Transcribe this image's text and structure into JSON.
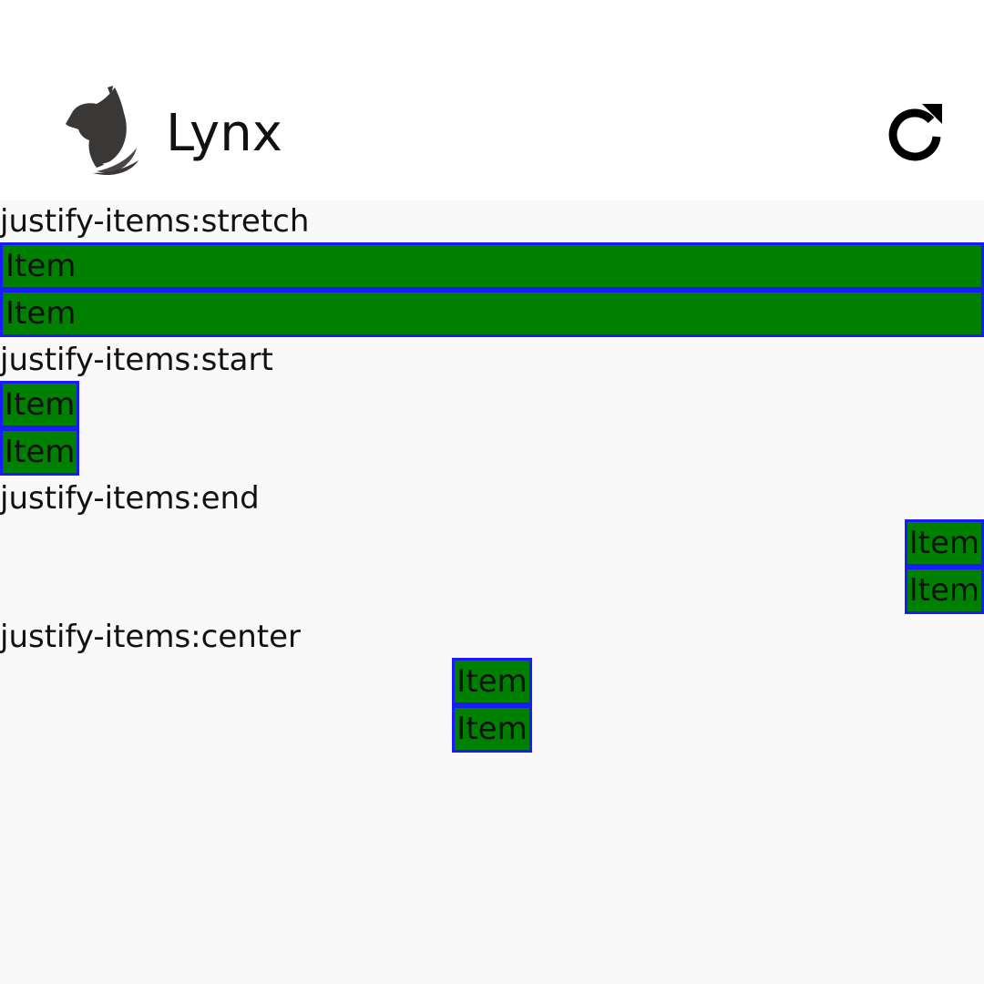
{
  "header": {
    "title": "Lynx",
    "logo_icon": "lynx-logo-icon",
    "refresh_icon": "refresh-icon"
  },
  "colors": {
    "item_background": "#008000",
    "item_border": "#1a1aff",
    "content_background": "#f9f9f9",
    "header_background": "#ffffff"
  },
  "sections": [
    {
      "label": "justify-items:stretch",
      "items": [
        "Item",
        "Item"
      ]
    },
    {
      "label": "justify-items:start",
      "items": [
        "Item",
        "Item"
      ]
    },
    {
      "label": "justify-items:end",
      "items": [
        "Item",
        "Item"
      ]
    },
    {
      "label": "justify-items:center",
      "items": [
        "Item",
        "Item"
      ]
    }
  ]
}
